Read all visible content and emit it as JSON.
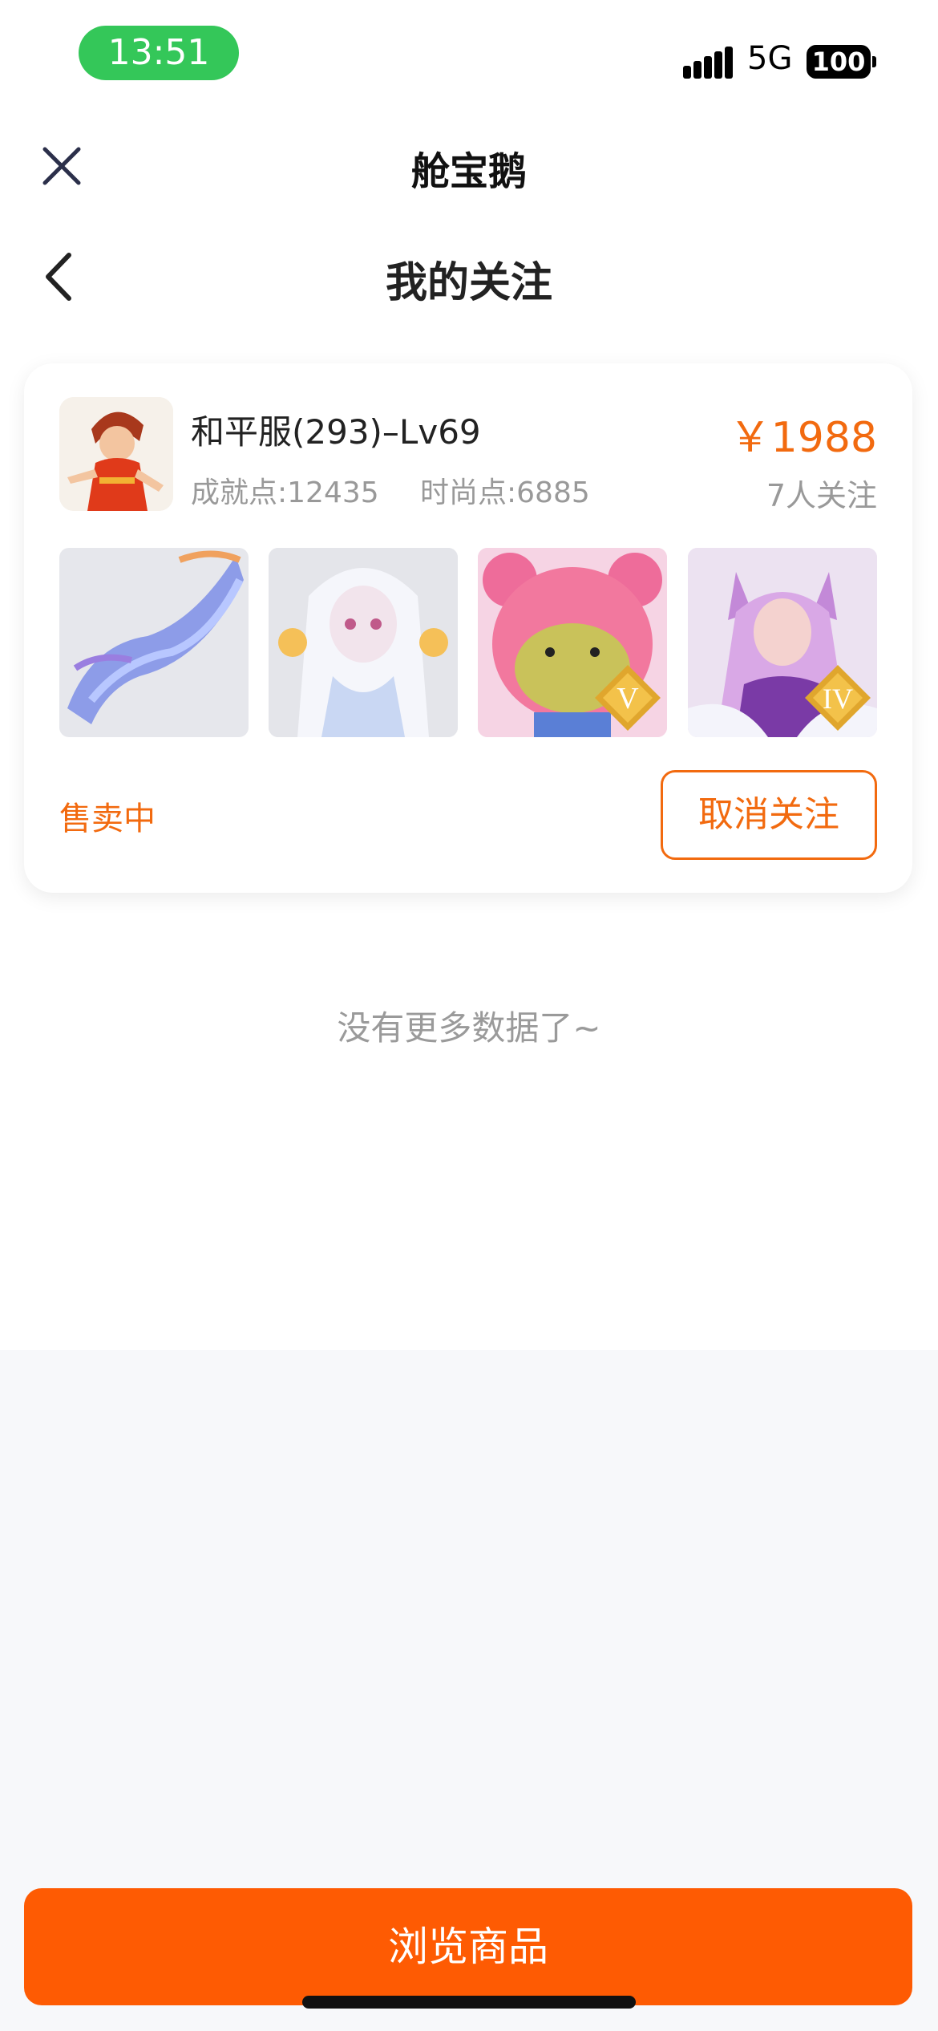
{
  "status_bar": {
    "time": "13:51",
    "network": "5G",
    "battery": "100"
  },
  "mini_program": {
    "title": "舱宝鹅",
    "close_icon": "close-icon"
  },
  "nav": {
    "title": "我的关注",
    "back_icon": "back-icon"
  },
  "listing": {
    "title": "和平服(293)–Lv69",
    "achievement_points": "成就点:12435",
    "fashion_points": "时尚点:6885",
    "price": "￥1988",
    "followers": "7人关注",
    "status": "售卖中",
    "unfollow_label": "取消关注",
    "thumbnails": [
      {
        "name": "dragon-image"
      },
      {
        "name": "white-spirit-image"
      },
      {
        "name": "pink-bear-image",
        "badge": "V"
      },
      {
        "name": "fox-girl-image",
        "badge": "IV"
      }
    ]
  },
  "list_footer": "没有更多数据了~",
  "bottom_button": "浏览商品",
  "colors": {
    "accent": "#f26a0f",
    "button": "#fe5b03",
    "status_pill": "#34c759"
  }
}
